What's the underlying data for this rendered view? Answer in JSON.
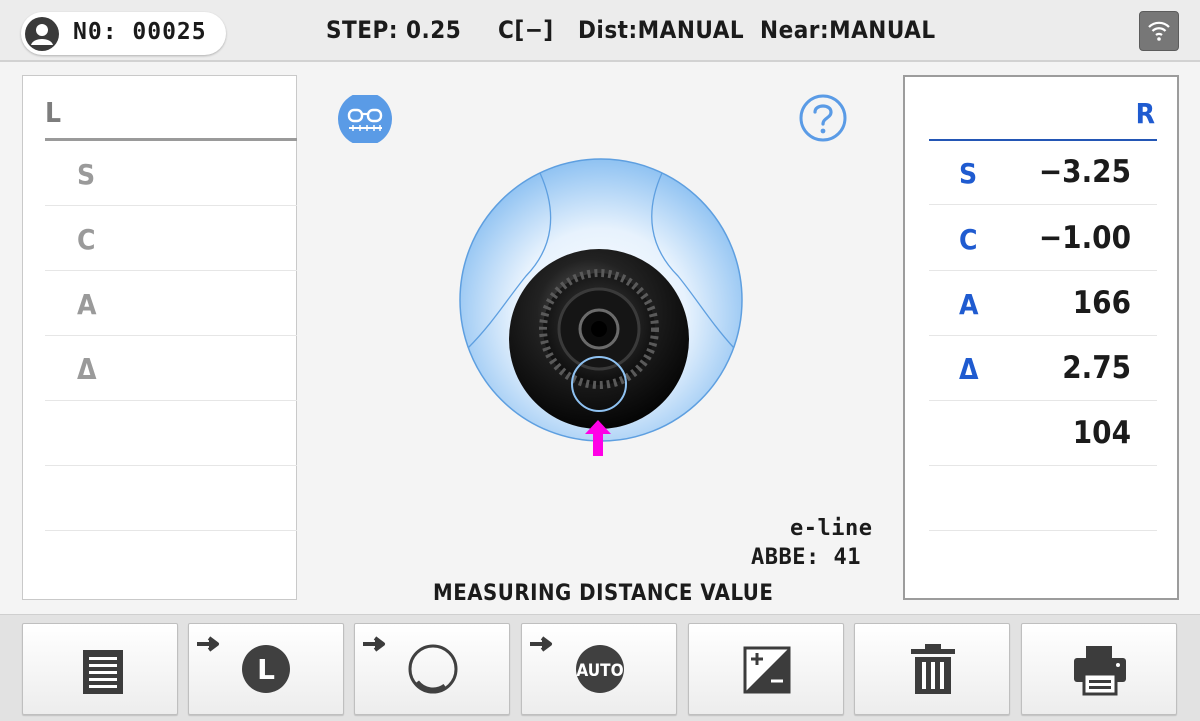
{
  "header": {
    "record_number": "N0: 00025",
    "step": "STEP: 0.25",
    "cylinder_mode": "C[−]",
    "dist_mode": "Dist:MANUAL",
    "near_mode": "Near:MANUAL",
    "icons": [
      "user-avatar-icon",
      "wifi-icon"
    ]
  },
  "left_panel": {
    "title": "L",
    "rows": [
      {
        "label": "S",
        "value": ""
      },
      {
        "label": "C",
        "value": ""
      },
      {
        "label": "A",
        "value": ""
      },
      {
        "label": "Δ",
        "value": ""
      },
      {
        "label": "",
        "value": ""
      },
      {
        "label": "",
        "value": ""
      }
    ]
  },
  "right_panel": {
    "title": "R",
    "rows": [
      {
        "label": "S",
        "value": "−3.25"
      },
      {
        "label": "C",
        "value": "−1.00"
      },
      {
        "label": "A",
        "value": "166"
      },
      {
        "label": "Δ",
        "value": "2.75"
      },
      {
        "label": "",
        "value": "104"
      },
      {
        "label": "",
        "value": ""
      }
    ]
  },
  "center": {
    "line_type": "e-line",
    "abbe": "ABBE: 41",
    "message": "MEASURING DISTANCE VALUE",
    "icons": [
      "glasses-icon",
      "help-icon",
      "lens-target-icon",
      "alignment-arrow-icon"
    ]
  },
  "toolbar": {
    "buttons": [
      {
        "name": "list-button",
        "icon": "list-icon"
      },
      {
        "name": "left-lens-button",
        "icon": "left-lens-icon"
      },
      {
        "name": "lens-mode-button",
        "icon": "circle-icon"
      },
      {
        "name": "auto-button",
        "icon": "auto-icon",
        "label": "AUTO"
      },
      {
        "name": "plus-minus-button",
        "icon": "plus-minus-icon"
      },
      {
        "name": "delete-button",
        "icon": "trash-icon"
      },
      {
        "name": "print-button",
        "icon": "printer-icon"
      }
    ],
    "left_label": "L"
  },
  "colors": {
    "accent_blue": "#1f5bd0",
    "alignment_arrow": "#ff00e6",
    "icon_dark": "#4a4a4a"
  }
}
